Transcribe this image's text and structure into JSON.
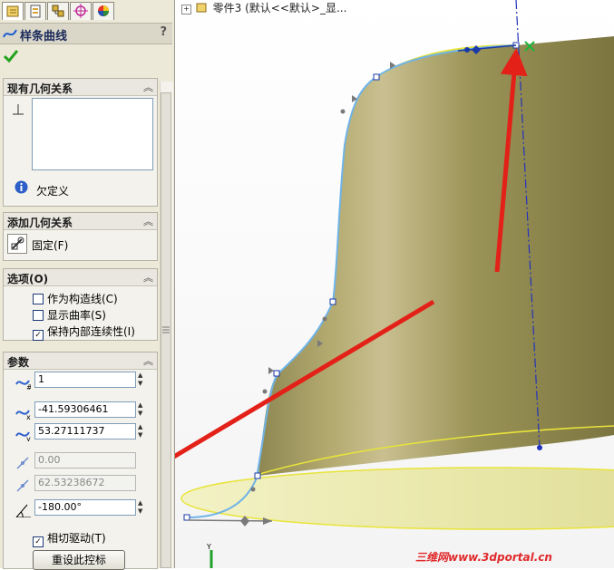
{
  "feature_tree": {
    "text": "零件3  (默认<<默认>_显..."
  },
  "panel": {
    "title": "样条曲线",
    "help": "?",
    "existing_relations": {
      "header": "现有几何关系",
      "status": "欠定义"
    },
    "add_relations": {
      "header": "添加几何关系",
      "fix_label": "固定(F)"
    },
    "options": {
      "header": "选项(O)",
      "construction": "作为构造线(C)",
      "show_curvature": "显示曲率(S)",
      "maintain_continuity": "保持内部连续性(I)"
    },
    "parameters": {
      "header": "参数",
      "point_number": "1",
      "x_value": "-41.59306461",
      "y_value": "53.27111737",
      "weight1": "0.00",
      "weight2": "62.53238672",
      "tangent_angle": "-180.00°",
      "tangent_driving": "相切驱动(T)",
      "reset_button": "重设此控标"
    }
  },
  "watermark": "三维网www.3dportal.cn",
  "axis_label": "Y",
  "colors": {
    "accent": "#1b2a5a",
    "model": "#b5ad72",
    "spline": "#6fb3e6",
    "arrow": "#e32118",
    "axis": "#2233bb"
  }
}
